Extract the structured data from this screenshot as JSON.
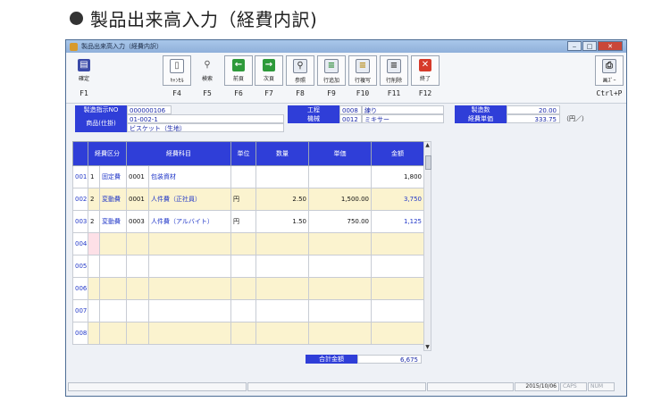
{
  "heading": "製品出来高入力（経費内訳)",
  "window": {
    "title": "製品出来高入力（経費内訳）",
    "buttons": [
      "‒",
      "□",
      "✕"
    ]
  },
  "toolbar": [
    {
      "label": "確定",
      "key": "F1",
      "icon": "save-icon"
    },
    {
      "label": "ｷｬﾝｾﾙ",
      "key": "F4",
      "icon": "document-icon"
    },
    {
      "label": "検索",
      "key": "F5",
      "icon": "magnifier-icon"
    },
    {
      "label": "前頁",
      "key": "F6",
      "icon": "arrow-left-icon"
    },
    {
      "label": "次頁",
      "key": "F7",
      "icon": "arrow-right-icon"
    },
    {
      "label": "参照",
      "key": "F8",
      "icon": "reference-icon"
    },
    {
      "label": "行追加",
      "key": "F9",
      "icon": "row-add-icon"
    },
    {
      "label": "行複写",
      "key": "F10",
      "icon": "row-copy-icon"
    },
    {
      "label": "行削除",
      "key": "F11",
      "icon": "row-delete-icon"
    },
    {
      "label": "終了",
      "key": "F12",
      "icon": "close-icon"
    },
    {
      "label": "画ｽﾞｰ",
      "key": "Ctrl+P",
      "icon": "printer-icon"
    }
  ],
  "header": {
    "order_no_label": "製造指示NO",
    "order_no": "000000106",
    "product_code": "01-002-1",
    "product_label": "商品(仕掛)",
    "product_name": "ビスケット（生地）",
    "process_label": "工程",
    "process_code": "0008",
    "process_name": "練り",
    "machine_label": "機械",
    "machine_code": "0012",
    "machine_name": "ミキサー",
    "qty_label": "製造数",
    "qty": "20.00",
    "unit_cost_label": "経費単価",
    "unit_cost": "333.75",
    "unit_cost_unit": "（円／）"
  },
  "grid": {
    "columns": [
      "経費区分",
      "経費科目",
      "単位",
      "数量",
      "単価",
      "金額"
    ],
    "rows": [
      {
        "no": "001",
        "kubun_code": "1",
        "kubun": "固定費",
        "kamoku_code": "0001",
        "kamoku": "包装資材",
        "unit": "",
        "qty": "",
        "price": "",
        "amount": "1,800"
      },
      {
        "no": "002",
        "kubun_code": "2",
        "kubun": "変動費",
        "kamoku_code": "0001",
        "kamoku": "人件費（正社員）",
        "unit": "円",
        "qty": "2.50",
        "price": "1,500.00",
        "amount": "3,750"
      },
      {
        "no": "003",
        "kubun_code": "2",
        "kubun": "変動費",
        "kamoku_code": "0003",
        "kamoku": "人件費（アルバイト）",
        "unit": "円",
        "qty": "1.50",
        "price": "750.00",
        "amount": "1,125"
      },
      {
        "no": "004",
        "kubun_code": "",
        "kubun": "",
        "kamoku_code": "",
        "kamoku": "",
        "unit": "",
        "qty": "",
        "price": "",
        "amount": ""
      },
      {
        "no": "005",
        "kubun_code": "",
        "kubun": "",
        "kamoku_code": "",
        "kamoku": "",
        "unit": "",
        "qty": "",
        "price": "",
        "amount": ""
      },
      {
        "no": "006",
        "kubun_code": "",
        "kubun": "",
        "kamoku_code": "",
        "kamoku": "",
        "unit": "",
        "qty": "",
        "price": "",
        "amount": ""
      },
      {
        "no": "007",
        "kubun_code": "",
        "kubun": "",
        "kamoku_code": "",
        "kamoku": "",
        "unit": "",
        "qty": "",
        "price": "",
        "amount": ""
      },
      {
        "no": "008",
        "kubun_code": "",
        "kubun": "",
        "kamoku_code": "",
        "kamoku": "",
        "unit": "",
        "qty": "",
        "price": "",
        "amount": ""
      }
    ],
    "total_label": "合計金額",
    "total": "6,675"
  },
  "status": {
    "date": "2015/10/06",
    "caps": "CAPS",
    "num": "NUM"
  },
  "colors": {
    "label_bg": "#2f3ed8",
    "alt_row": "#fbf3cf",
    "selected_cell": "#fde0e7"
  }
}
